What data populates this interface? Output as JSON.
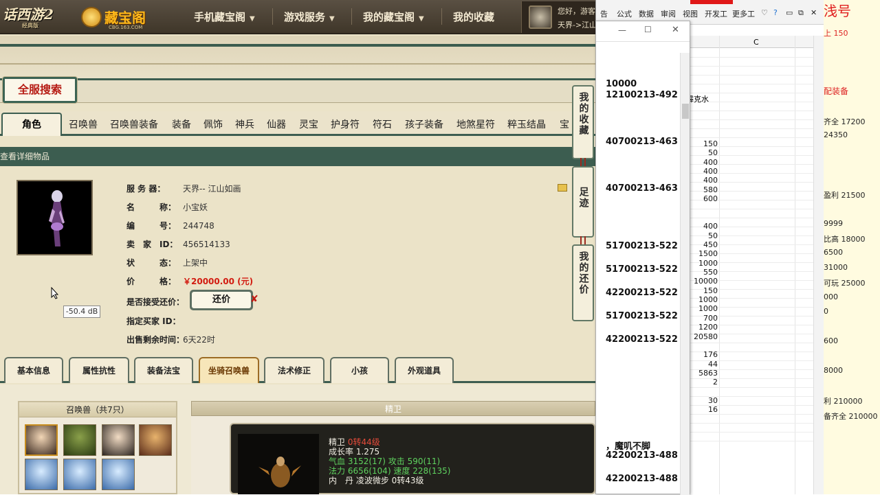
{
  "game": {
    "logo_text": "话西游2",
    "logo_sub": "经典版",
    "cbg_logo": "藏宝阁",
    "cbg_url": "CBG.163.COM",
    "nav": [
      {
        "label": "手机藏宝阁",
        "dropdown": true
      },
      {
        "label": "游戏服务",
        "dropdown": true
      },
      {
        "label": "我的藏宝阁",
        "dropdown": true
      },
      {
        "label": "我的收藏",
        "dropdown": false
      }
    ],
    "user": {
      "greeting": "您好，游客",
      "server": "天界->江山"
    },
    "search_title": "全服搜索",
    "tabs": [
      "角色",
      "召唤兽",
      "召唤兽装备",
      "装备",
      "佩饰",
      "神兵",
      "仙器",
      "灵宝",
      "护身符",
      "符石",
      "孩子装备",
      "地煞星符",
      "粹玉结晶",
      "宝"
    ],
    "content_title": "查看详细物品",
    "fields": [
      {
        "key": "服 务 器：",
        "value": "天界-- 江山如画"
      },
      {
        "key": "名　　　称：",
        "value": "小宝妖"
      },
      {
        "key": "编　　　号：",
        "value": "244748"
      },
      {
        "key": "卖　家　ID：",
        "value": "456514133"
      },
      {
        "key": "状　　　态：",
        "value": "上架中"
      },
      {
        "key": "价　　　格：",
        "value": "￥20000.00 (元)"
      },
      {
        "key": "是否接受还价：",
        "value": ""
      },
      {
        "key": "指定买家 ID：",
        "value": ""
      },
      {
        "key": "出售剩余时间：",
        "value": "6天22时"
      }
    ],
    "offer_button": "还价",
    "offer_x": "✘",
    "tooltip": "-50.4 dB",
    "side_buttons": [
      "我的收藏",
      "足迹",
      "我的还价"
    ],
    "bottom_tabs": [
      "基本信息",
      "属性抗性",
      "装备法宝",
      "坐骑召唤兽",
      "法术修正",
      "小孩",
      "外观道具"
    ],
    "active_bottom_tab": "坐骑召唤兽",
    "pets_header": "召唤兽（共7只）",
    "jw_header": "精卫",
    "jw_lines": [
      {
        "a": "精卫 ",
        "b": "0转44级"
      },
      {
        "a": "成长率 1.275",
        "b": ""
      },
      {
        "a": "气血 3152(17) 攻击 590(11)",
        "b": ""
      },
      {
        "a": "法力 6656(104) 速度 228(135)",
        "b": ""
      },
      {
        "a": "内　丹 凌波微步 0转43级",
        "b": ""
      }
    ]
  },
  "excel": {
    "ribbon_tabs": [
      "告",
      "公式",
      "数据",
      "审阅",
      "视图",
      "开发工",
      "更多工"
    ],
    "column_label": "C",
    "dialog_lines": [
      "10000",
      "12100213-492",
      "40700213-463",
      "40700213-463",
      "51700213-522",
      "51700213-522",
      "42200213-522",
      "51700213-522",
      "42200213-522",
      "，魔叽不脚",
      "42200213-488",
      "42200213-488"
    ],
    "cell_text": "霹克水",
    "numbers": [
      "150",
      "50",
      "400",
      "400",
      "400",
      "580",
      "600",
      "400",
      "50",
      "450",
      "1500",
      "1000",
      "550",
      "10000",
      "150",
      "1000",
      "1000",
      "700",
      "1200",
      "20580",
      "176",
      "44",
      "5863",
      "2",
      "30",
      "16"
    ]
  },
  "right_notes": [
    "浅号",
    "上 150",
    "配装备",
    "齐全 17200",
    "24350",
    "盈利 21500",
    "9999",
    "比高 18000",
    "6500",
    "31000",
    "可玩 25000",
    "000",
    "0",
    "600",
    "8000",
    "利 210000",
    "备齐全 210000"
  ],
  "colors": {
    "accent_green": "#3c5d50",
    "price_red": "#d21b10",
    "nav_bg": "#4a4134"
  }
}
